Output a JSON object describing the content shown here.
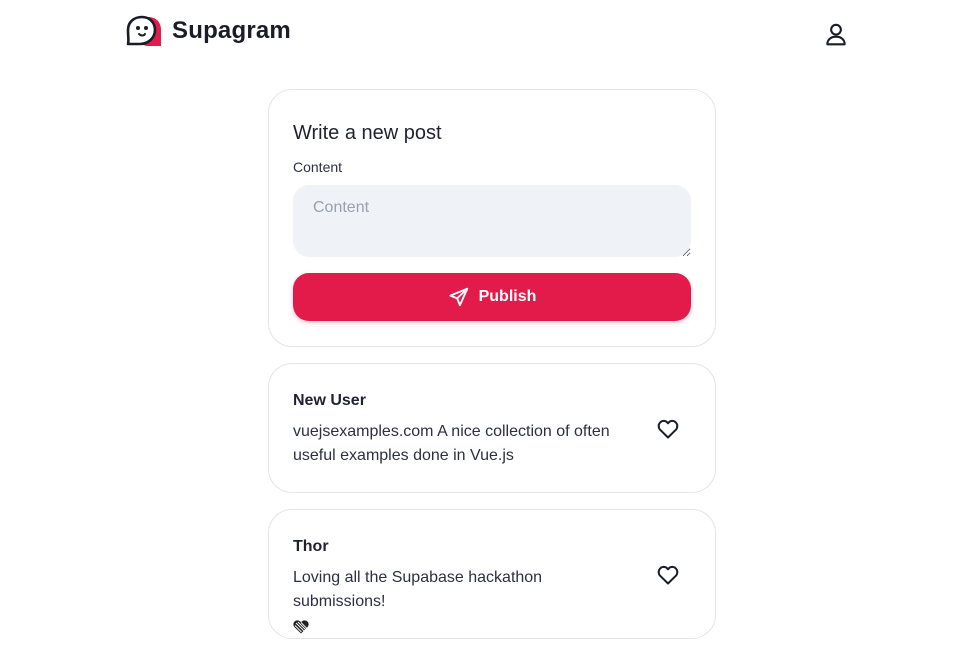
{
  "header": {
    "brand_name": "Supagram",
    "logo_icon": "ghost-logo-icon",
    "profile_icon": "user-icon"
  },
  "composer": {
    "title": "Write a new post",
    "content_label": "Content",
    "content_placeholder": "Content",
    "content_value": "",
    "publish_label": "Publish",
    "publish_icon": "send-icon"
  },
  "posts": [
    {
      "author": "New User",
      "body": "vuejsexamples.com A nice collection of often useful examples done in Vue.js",
      "emoji": "",
      "like_icon": "heart-outline-icon"
    },
    {
      "author": "Thor",
      "body": "Loving all the Supabase hackathon submissions!",
      "emoji": "black-heart-icon",
      "like_icon": "heart-outline-icon"
    }
  ],
  "colors": {
    "accent": "#e31b4b",
    "input_bg": "#eff2f6",
    "border": "#e3e5ea",
    "text": "#1f2330"
  }
}
